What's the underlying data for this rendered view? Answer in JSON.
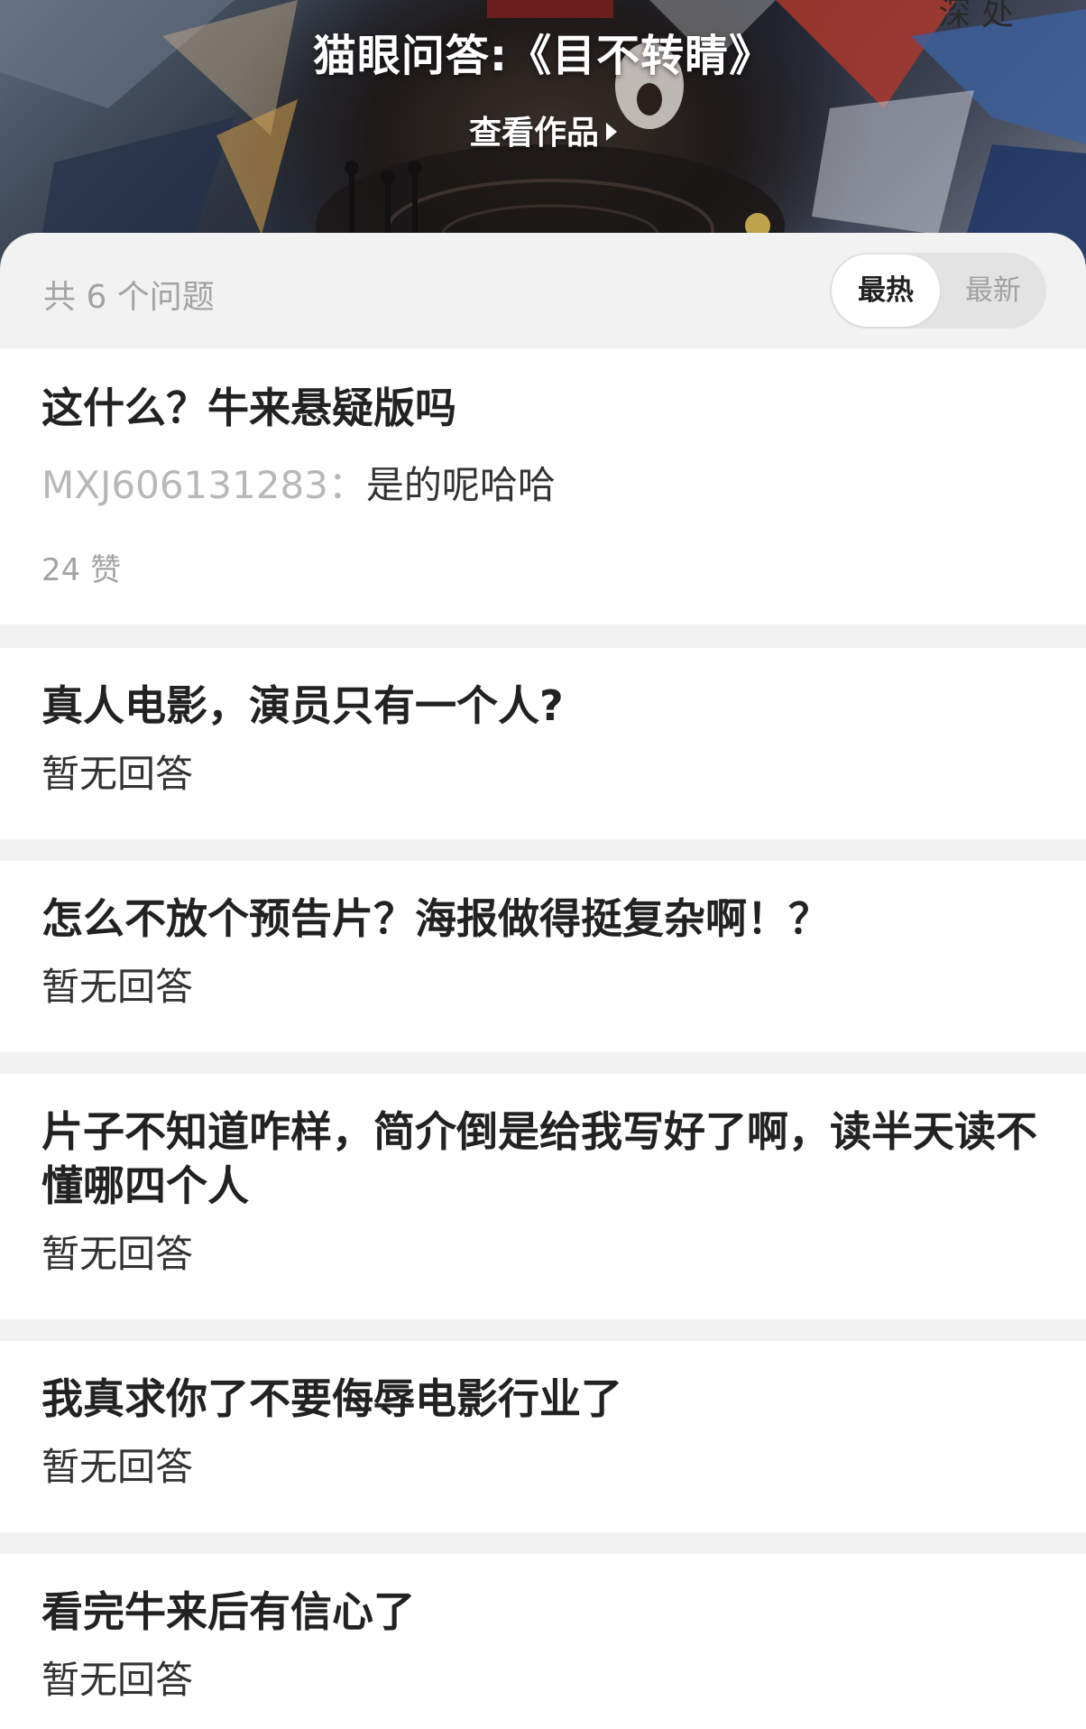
{
  "poster": {
    "title": "猫眼问答:《目不转睛》",
    "view_work_label": "查看作品",
    "corner_text": "深 处"
  },
  "list_header": {
    "count_label": "共 6 个问题",
    "sort_options": [
      "最热",
      "最新"
    ],
    "selected_sort": "最热"
  },
  "questions": [
    {
      "title": "这什么？牛来悬疑版吗",
      "answer_user": "MXJ606131283：",
      "answer_text": "是的呢哈哈",
      "likes": "24 赞"
    },
    {
      "title": "真人电影，演员只有一个人?",
      "status": "暂无回答"
    },
    {
      "title": "怎么不放个预告片？海报做得挺复杂啊！？",
      "status": "暂无回答"
    },
    {
      "title": "片子不知道咋样，简介倒是给我写好了啊，读半天读不懂哪四个人",
      "status": "暂无回答"
    },
    {
      "title": "我真求你了不要侮辱电影行业了",
      "status": "暂无回答"
    },
    {
      "title": "看完牛来后有信心了",
      "status": "暂无回答"
    }
  ],
  "colors": {
    "background": "#f2f2f2",
    "card": "#ffffff",
    "title_text": "#222222",
    "muted_text": "#a3a3a3"
  }
}
